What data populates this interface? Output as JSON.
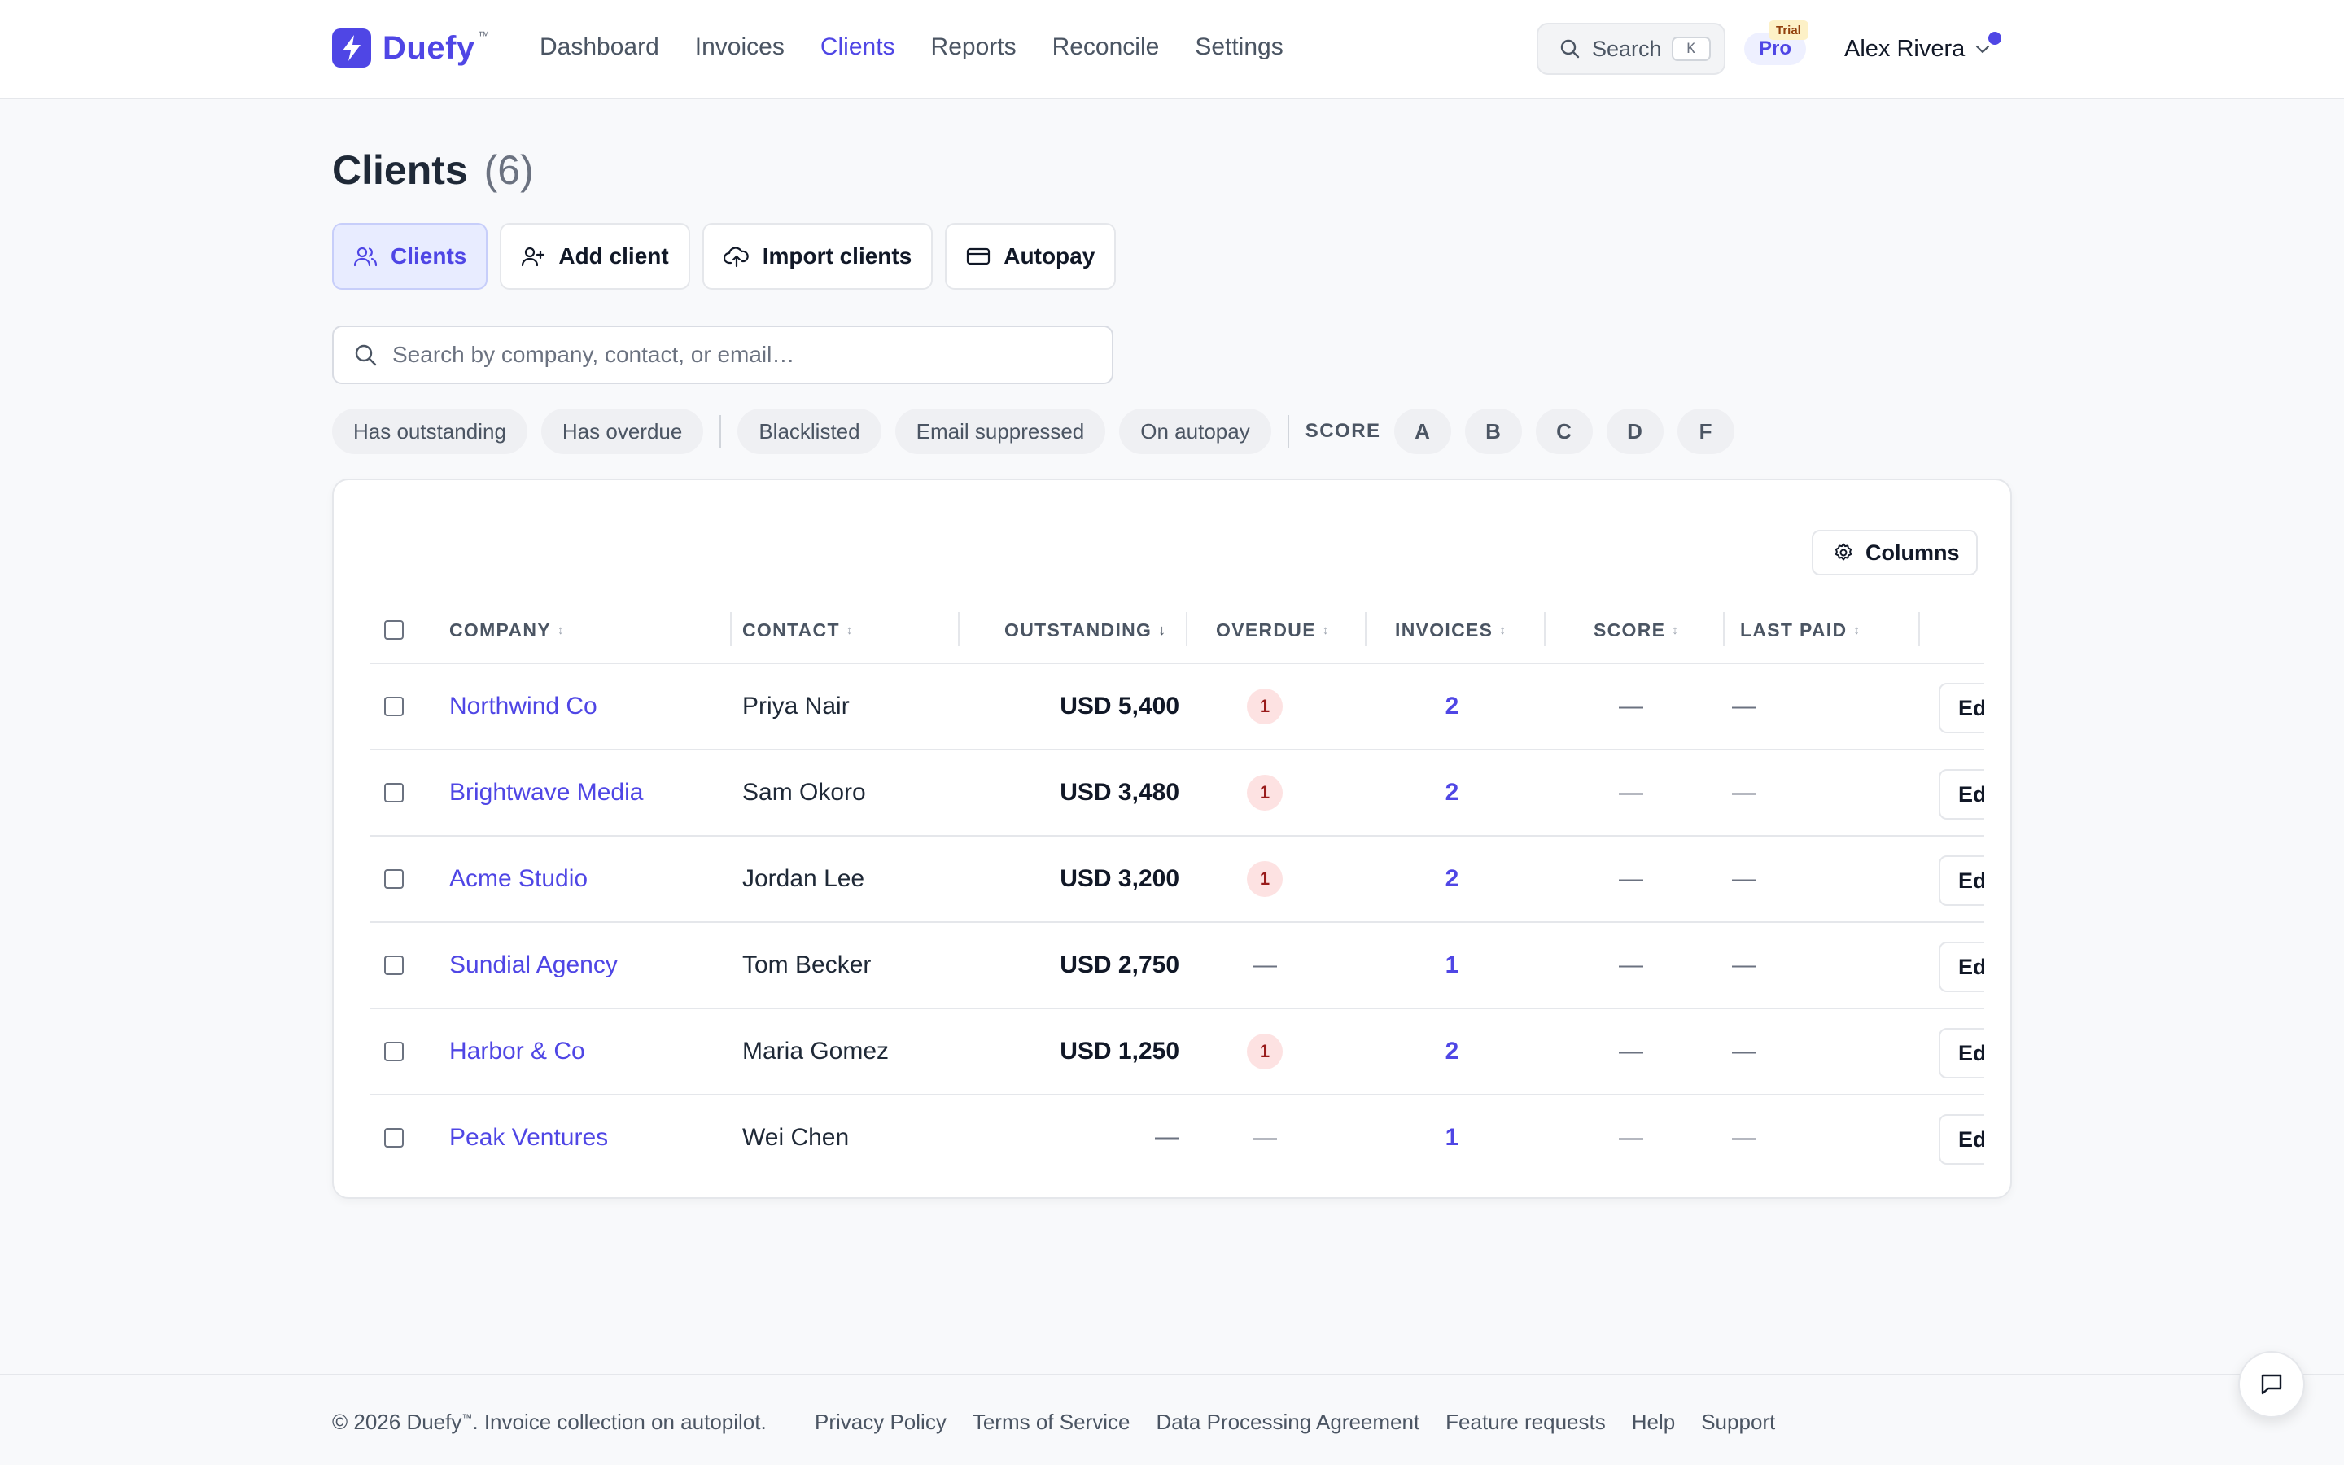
{
  "brand": {
    "name": "Duefy",
    "tm": "™",
    "accent": "#4f46e5"
  },
  "nav": {
    "links": [
      "Dashboard",
      "Invoices",
      "Clients",
      "Reports",
      "Reconcile",
      "Settings"
    ],
    "active": "Clients",
    "search_label": "Search",
    "search_kbd": "K",
    "plan": "Pro",
    "plan_badge": "Trial",
    "user_name": "Alex Rivera"
  },
  "page": {
    "title": "Clients",
    "count": "(6)"
  },
  "tabs": [
    {
      "label": "Clients",
      "icon": "users-icon",
      "active": true
    },
    {
      "label": "Add client",
      "icon": "user-plus-icon",
      "active": false
    },
    {
      "label": "Import clients",
      "icon": "cloud-upload-icon",
      "active": false
    },
    {
      "label": "Autopay",
      "icon": "credit-card-icon",
      "active": false
    }
  ],
  "search": {
    "placeholder": "Search by company, contact, or email…",
    "value": ""
  },
  "filters": {
    "chips_group1": [
      "Has outstanding",
      "Has overdue"
    ],
    "chips_group2": [
      "Blacklisted",
      "Email suppressed",
      "On autopay"
    ],
    "score_label": "SCORE",
    "grades": [
      "A",
      "B",
      "C",
      "D",
      "F"
    ]
  },
  "table": {
    "columns_button": "Columns",
    "headers": {
      "company": "COMPANY",
      "contact": "CONTACT",
      "outstanding": "OUTSTANDING",
      "overdue": "OVERDUE",
      "invoices": "INVOICES",
      "score": "SCORE",
      "last_paid": "LAST PAID"
    },
    "sort_icon": "↕",
    "sort_active_icon": "↓",
    "edit_label": "Edi",
    "empty": "—",
    "rows": [
      {
        "company": "Northwind Co",
        "contact": "Priya Nair",
        "outstanding": "USD 5,400",
        "overdue": "1",
        "invoices": "2",
        "score": "—",
        "last_paid": "—"
      },
      {
        "company": "Brightwave Media",
        "contact": "Sam Okoro",
        "outstanding": "USD 3,480",
        "overdue": "1",
        "invoices": "2",
        "score": "—",
        "last_paid": "—"
      },
      {
        "company": "Acme Studio",
        "contact": "Jordan Lee",
        "outstanding": "USD 3,200",
        "overdue": "1",
        "invoices": "2",
        "score": "—",
        "last_paid": "—"
      },
      {
        "company": "Sundial Agency",
        "contact": "Tom Becker",
        "outstanding": "USD 2,750",
        "overdue": "—",
        "invoices": "1",
        "score": "—",
        "last_paid": "—"
      },
      {
        "company": "Harbor & Co",
        "contact": "Maria Gomez",
        "outstanding": "USD 1,250",
        "overdue": "1",
        "invoices": "2",
        "score": "—",
        "last_paid": "—"
      },
      {
        "company": "Peak Ventures",
        "contact": "Wei Chen",
        "outstanding": "—",
        "overdue": "—",
        "invoices": "1",
        "score": "—",
        "last_paid": "—"
      }
    ]
  },
  "footer": {
    "copyright_pre": "© 2026 Duefy",
    "copyright_tm": "™",
    "copyright_post": ". Invoice collection on autopilot.",
    "links": [
      "Privacy Policy",
      "Terms of Service",
      "Data Processing Agreement",
      "Feature requests",
      "Help",
      "Support"
    ]
  },
  "chat": {
    "icon": "chat-bubble-icon"
  }
}
